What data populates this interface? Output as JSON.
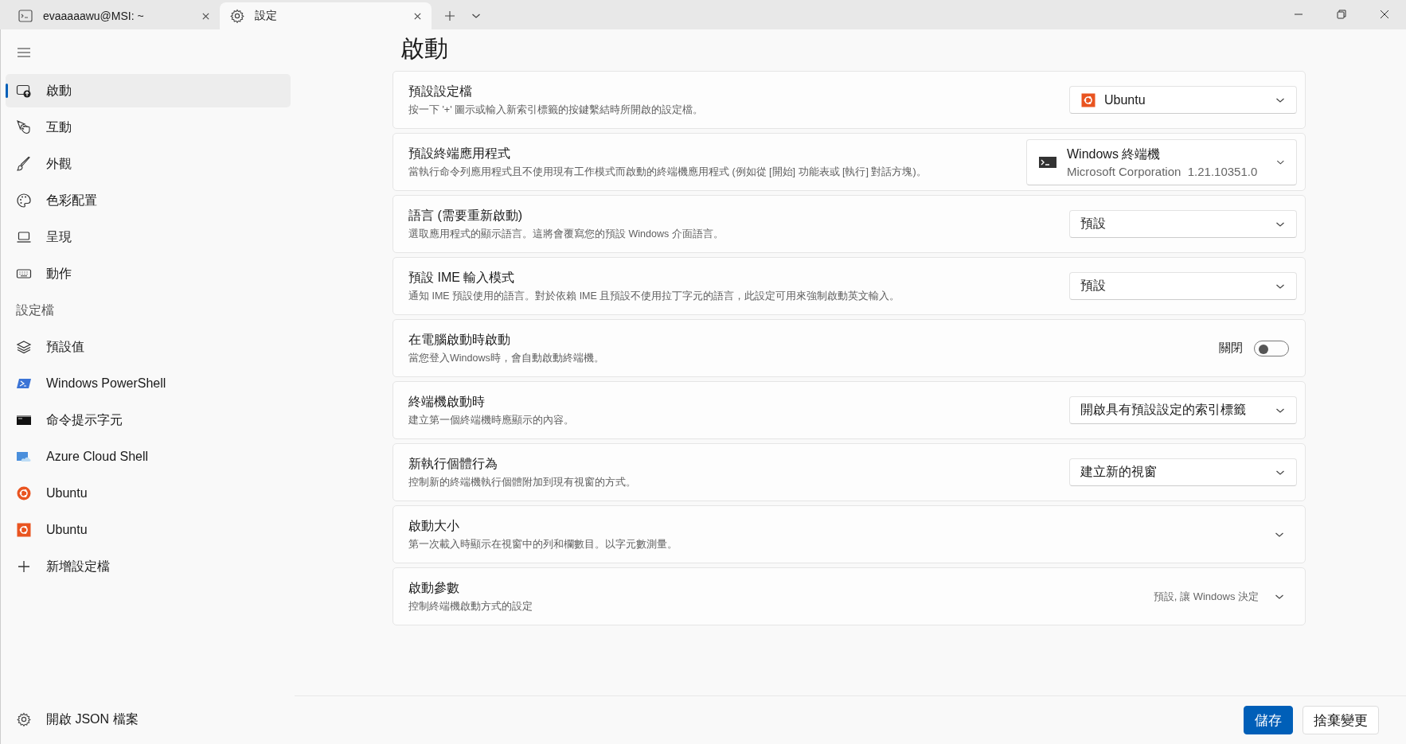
{
  "tabs": [
    {
      "label": "evaaaaawu@MSI: ~",
      "selected": false
    },
    {
      "label": "設定",
      "selected": true
    }
  ],
  "sidebar": {
    "items": [
      {
        "kind": "nav",
        "label": "啟動",
        "selected": true
      },
      {
        "kind": "nav",
        "label": "互動",
        "selected": false
      },
      {
        "kind": "nav",
        "label": "外觀",
        "selected": false
      },
      {
        "kind": "nav",
        "label": "色彩配置",
        "selected": false
      },
      {
        "kind": "nav",
        "label": "呈現",
        "selected": false
      },
      {
        "kind": "nav",
        "label": "動作",
        "selected": false
      },
      {
        "kind": "header",
        "label": "設定檔"
      },
      {
        "kind": "nav",
        "label": "預設值",
        "selected": false
      },
      {
        "kind": "nav",
        "label": "Windows PowerShell",
        "selected": false
      },
      {
        "kind": "nav",
        "label": "命令提示字元",
        "selected": false
      },
      {
        "kind": "nav",
        "label": "Azure Cloud Shell",
        "selected": false
      },
      {
        "kind": "nav",
        "label": "Ubuntu",
        "selected": false
      },
      {
        "kind": "nav",
        "label": "Ubuntu",
        "selected": false
      },
      {
        "kind": "nav",
        "label": "新增設定檔",
        "selected": false
      }
    ],
    "footer": {
      "label": "開啟 JSON 檔案"
    }
  },
  "page_title": "啟動",
  "settings": [
    {
      "kind": "dropdown",
      "title": "預設設定檔",
      "description": "按一下 '+' 圖示或輸入新索引標籤的按鍵繫結時所開啟的設定檔。",
      "value": "Ubuntu"
    },
    {
      "kind": "dropdown",
      "title": "預設終端應用程式",
      "description": "當執行命令列應用程式且不使用現有工作模式而啟動的終端機應用程式 (例如從 [開始] 功能表或 [執行] 對話方塊)。",
      "value": "Windows 終端機",
      "value_detail": "Microsoft Corporation  1.21.10351.0"
    },
    {
      "kind": "dropdown",
      "title": "語言 (需要重新啟動)",
      "description": "選取應用程式的顯示語言。這將會覆寫您的預設 Windows 介面語言。",
      "value": "預設"
    },
    {
      "kind": "dropdown",
      "title": "預設 IME 輸入模式",
      "description": "通知 IME 預設使用的語言。對於依賴 IME 且預設不使用拉丁字元的語言，此設定可用來強制啟動英文輸入。",
      "value": "預設"
    },
    {
      "kind": "toggle",
      "title": "在電腦啟動時啟動",
      "description": "當您登入Windows時，會自動啟動終端機。",
      "state_label": "關閉",
      "on": false
    },
    {
      "kind": "dropdown",
      "title": "終端機啟動時",
      "description": "建立第一個終端機時應顯示的內容。",
      "value": "開啟具有預設設定的索引標籤"
    },
    {
      "kind": "dropdown",
      "title": "新執行個體行為",
      "description": "控制新的終端機執行個體附加到現有視窗的方式。",
      "value": "建立新的視窗"
    },
    {
      "kind": "expander",
      "title": "啟動大小",
      "description": "第一次載入時顯示在視窗中的列和欄數目。以字元數測量。"
    },
    {
      "kind": "expander",
      "title": "啟動參數",
      "description": "控制終端機啟動方式的設定",
      "value": "預設, 讓 Windows 決定"
    }
  ],
  "buttons": [
    {
      "label": "儲存",
      "kind": "primary"
    },
    {
      "label": "捨棄變更",
      "kind": "secondary"
    }
  ]
}
